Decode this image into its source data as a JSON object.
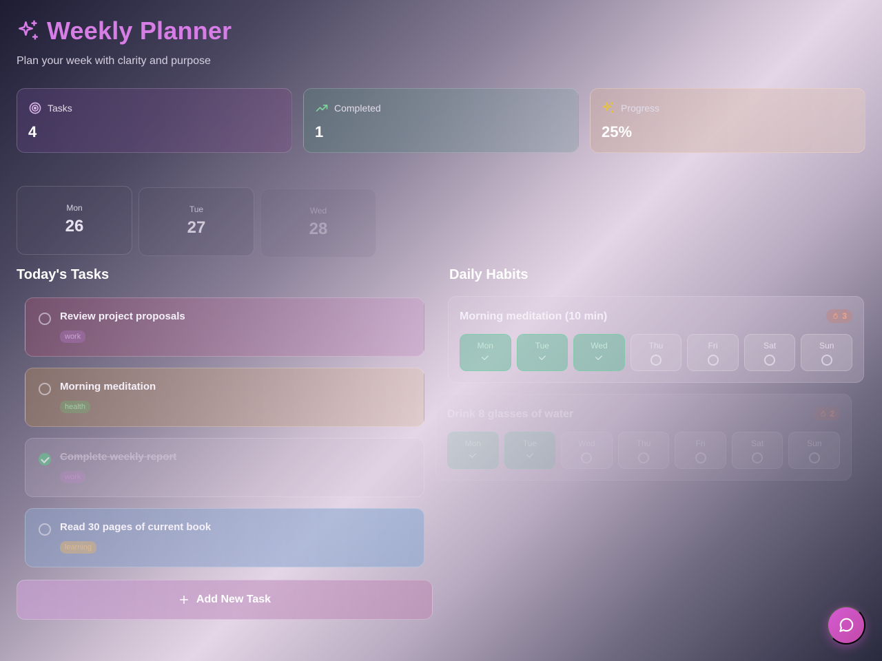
{
  "header": {
    "title": "Weekly Planner",
    "subtitle": "Plan your week with clarity and purpose",
    "icon": "sparkles-icon"
  },
  "stats": {
    "tasks": {
      "label": "Tasks",
      "value": "4",
      "icon": "target-icon"
    },
    "completed": {
      "label": "Completed",
      "value": "1",
      "icon": "trending-up-icon"
    },
    "progress": {
      "label": "Progress",
      "value": "25%",
      "icon": "sparkles-icon"
    }
  },
  "week": [
    {
      "day": "Mon",
      "date": "26"
    },
    {
      "day": "Tue",
      "date": "27"
    },
    {
      "day": "Wed",
      "date": "28"
    }
  ],
  "tasks_section": {
    "title": "Today's Tasks",
    "items": [
      {
        "name": "Review project proposals",
        "tag": "work",
        "done": false
      },
      {
        "name": "Morning meditation",
        "tag": "health",
        "done": false
      },
      {
        "name": "Complete weekly report",
        "tag": "work",
        "done": true
      },
      {
        "name": "Read 30 pages of current book",
        "tag": "learning",
        "done": false
      }
    ],
    "add_label": "Add New Task"
  },
  "habits_section": {
    "title": "Daily Habits",
    "habits": [
      {
        "name": "Morning meditation (10 min)",
        "streak": "3",
        "days": [
          {
            "d": "Mon",
            "done": true
          },
          {
            "d": "Tue",
            "done": true
          },
          {
            "d": "Wed",
            "done": true
          },
          {
            "d": "Thu",
            "done": false
          },
          {
            "d": "Fri",
            "done": false
          },
          {
            "d": "Sat",
            "done": false
          },
          {
            "d": "Sun",
            "done": false
          }
        ]
      },
      {
        "name": "Drink 8 glasses of water",
        "streak": "2",
        "days": [
          {
            "d": "Mon",
            "done": true
          },
          {
            "d": "Tue",
            "done": true
          },
          {
            "d": "Wed",
            "done": false
          },
          {
            "d": "Thu",
            "done": false
          },
          {
            "d": "Fri",
            "done": false
          },
          {
            "d": "Sat",
            "done": false
          },
          {
            "d": "Sun",
            "done": false
          }
        ]
      }
    ]
  },
  "colors": {
    "title": "#d77ee6",
    "accent": "#c24aa8",
    "done": "#6fc494"
  }
}
